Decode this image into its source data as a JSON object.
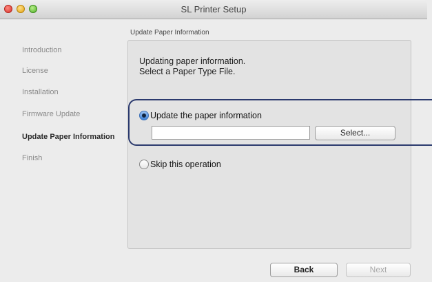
{
  "window": {
    "title": "SL Printer Setup"
  },
  "sidebar": {
    "items": [
      {
        "label": "Introduction",
        "active": false
      },
      {
        "label": "License",
        "active": false
      },
      {
        "label": "Installation",
        "active": false
      },
      {
        "label": "Firmware Update",
        "active": false
      },
      {
        "label": "Update Paper Information",
        "active": true
      },
      {
        "label": "Finish",
        "active": false
      }
    ]
  },
  "panel": {
    "label": "Update Paper Information",
    "description": [
      "Updating paper information.",
      "Select a Paper Type File."
    ]
  },
  "options": {
    "update": {
      "label": "Update the paper information",
      "selected": true
    },
    "skip": {
      "label": "Skip this operation",
      "selected": false
    }
  },
  "file": {
    "value": "",
    "select_label": "Select..."
  },
  "footer": {
    "back_label": "Back",
    "next_label": "Next",
    "next_enabled": false
  }
}
